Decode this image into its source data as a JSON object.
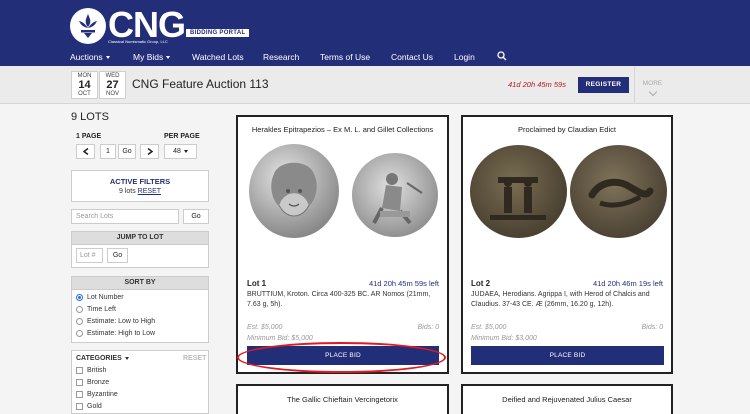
{
  "brand": {
    "logo_text": "CNG",
    "logo_subtext": "Classical Numismatic Group, LLC",
    "portal_badge": "BIDDING PORTAL"
  },
  "nav": {
    "items": [
      {
        "label": "Auctions",
        "dropdown": true
      },
      {
        "label": "My Bids",
        "dropdown": true
      },
      {
        "label": "Watched Lots",
        "dropdown": false
      },
      {
        "label": "Research",
        "dropdown": false
      },
      {
        "label": "Terms of Use",
        "dropdown": false
      },
      {
        "label": "Contact Us",
        "dropdown": false
      },
      {
        "label": "Login",
        "dropdown": false
      }
    ],
    "search_icon": "search-icon"
  },
  "auction": {
    "start": {
      "dow": "MON",
      "day": "14",
      "mon": "OCT"
    },
    "end": {
      "dow": "WED",
      "day": "27",
      "mon": "NOV"
    },
    "title": "CNG Feature Auction 113",
    "countdown": "41d 20h 45m 59s",
    "register_label": "REGISTER",
    "more_label": "MORE"
  },
  "sidebar": {
    "lots_count": "9 LOTS",
    "page_label": "1 PAGE",
    "per_page_label": "PER PAGE",
    "page_value": "1",
    "go_label": "Go",
    "per_page_value": "48",
    "active_filters_title": "ACTIVE FILTERS",
    "active_filters_count": "9 lots",
    "reset_label": "RESET",
    "search_placeholder": "Search Lots",
    "jump_title": "JUMP TO LOT",
    "lot_placeholder": "Lot #",
    "sort_title": "SORT BY",
    "sort_options": [
      "Lot Number",
      "Time Left",
      "Estimate: Low to High",
      "Estimate: High to Low"
    ],
    "sort_selected": "Lot Number",
    "categories_title": "CATEGORIES",
    "categories_reset": "RESET",
    "categories": [
      "British",
      "Bronze",
      "Byzantine",
      "Gold"
    ]
  },
  "lots": [
    {
      "header": "Herakles Epitrapezios – Ex M. L. and Gillet Collections",
      "lot": "Lot 1",
      "time_left": "41d 20h 45m 59s left",
      "description": "BRUTTIUM, Kroton. Circa 400-325 BC. AR Nomos (21mm, 7.63 g, 5h).",
      "estimate": "Est. $5,000",
      "bids": "Bids: 0",
      "min_bid": "Minimum Bid: $5,000",
      "button": "PLACE BID"
    },
    {
      "header": "Proclaimed by Claudian Edict",
      "lot": "Lot 2",
      "time_left": "41d 20h 46m 19s left",
      "description": "JUDAEA, Herodians. Agrippa I, with Herod of Chalcis and Claudius. 37-43 CE. Æ (26mm, 16.20 g, 12h).",
      "estimate": "Est. $5,000",
      "bids": "Bids: 0",
      "min_bid": "Minimum Bid: $3,000",
      "button": "PLACE BID"
    },
    {
      "header": "The Gallic Chieftain Vercingetorix"
    },
    {
      "header": "Deified and Rejuvenated Julius Caesar"
    }
  ],
  "colors": {
    "navy": "#232e78",
    "highlight_oval": "#e01a22",
    "countdown": "#b5161e"
  }
}
